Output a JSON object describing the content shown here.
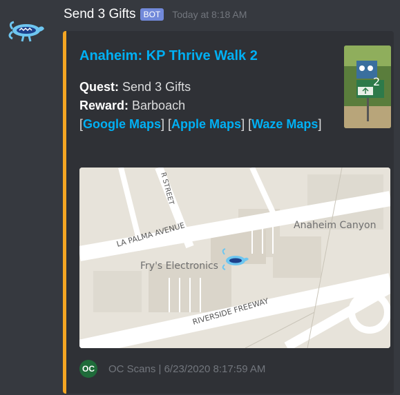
{
  "message": {
    "username": "Send 3 Gifts",
    "bot_tag": "BOT",
    "timestamp": "Today at 8:18 AM"
  },
  "embed": {
    "accent_color": "#f5a623",
    "title": "Anaheim: KP Thrive Walk 2",
    "quest_label": "Quest:",
    "quest_value": "Send 3 Gifts",
    "reward_label": "Reward:",
    "reward_value": "Barboach",
    "links": {
      "google": "Google Maps",
      "apple": "Apple Maps",
      "waze": "Waze Maps"
    },
    "map": {
      "labels": {
        "street": "R STREET",
        "la_palma": "LA PALMA AVENUE",
        "canyon": "Anaheim Canyon",
        "frys": "Fry's Electronics",
        "freeway": "RIVERSIDE FREEWAY"
      }
    },
    "footer": {
      "icon_text": "OC",
      "text": "OC Scans | 6/23/2020 8:17:59 AM"
    }
  }
}
